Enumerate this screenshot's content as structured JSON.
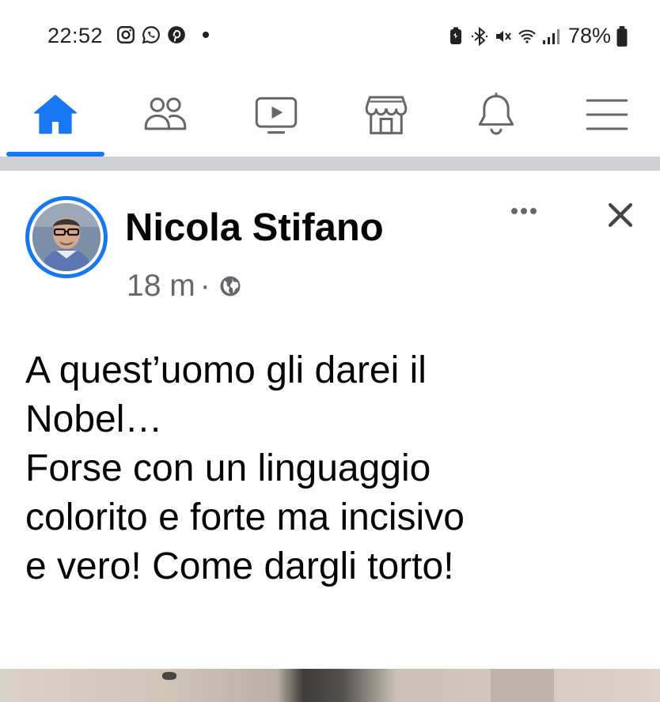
{
  "status_bar": {
    "time": "22:52",
    "left_icons": [
      "instagram-icon",
      "whatsapp-icon",
      "pinterest-icon",
      "notification-dot"
    ],
    "right_icons": [
      "battery-saver-icon",
      "bluetooth-icon",
      "mute-icon",
      "wifi-icon",
      "signal-icon"
    ],
    "battery": "78%"
  },
  "nav": {
    "items": [
      {
        "name": "home",
        "icon": "home-icon",
        "active": true
      },
      {
        "name": "friends",
        "icon": "friends-icon",
        "active": false
      },
      {
        "name": "watch",
        "icon": "video-icon",
        "active": false
      },
      {
        "name": "marketplace",
        "icon": "marketplace-icon",
        "active": false
      },
      {
        "name": "notifications",
        "icon": "bell-icon",
        "active": false
      },
      {
        "name": "menu",
        "icon": "hamburger-menu-icon",
        "active": false
      }
    ],
    "accent": "#1877f2"
  },
  "post": {
    "author": "Nicola Stifano",
    "time": "18 m",
    "separator": "·",
    "privacy_icon": "globe-icon",
    "text_lines": [
      "A quest’uomo gli darei il",
      "Nobel…",
      "Forse con un linguaggio",
      "colorito e forte ma incisivo",
      "e vero! Come dargli torto!"
    ]
  },
  "colors": {
    "primary_text": "#050505",
    "secondary_text": "#65676b",
    "divider": "#ced0d4"
  }
}
